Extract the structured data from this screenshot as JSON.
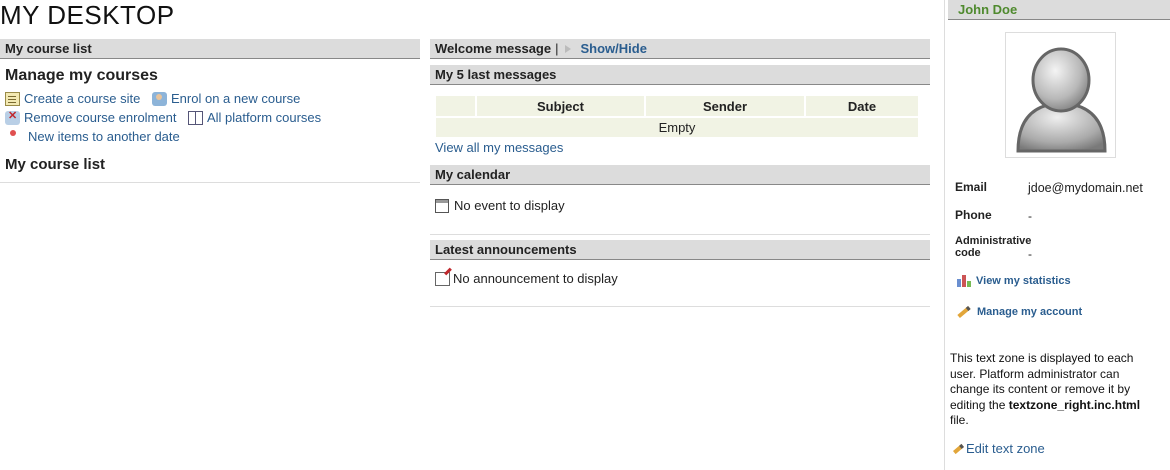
{
  "page_title": "MY DESKTOP",
  "left": {
    "bar_title": "My course list",
    "manage_title": "Manage my courses",
    "links": {
      "create": "Create a course site",
      "enrol": "Enrol on a new course",
      "remove": "Remove course enrolment",
      "all": "All platform courses",
      "new_items": "New items to another date"
    },
    "course_list_title": "My course list"
  },
  "mid": {
    "welcome": "Welcome message",
    "separator": "|",
    "show_hide": "Show/Hide",
    "messages_title": "My 5 last messages",
    "columns": [
      "Subject",
      "Sender",
      "Date"
    ],
    "empty": "Empty",
    "view_all": "View all my messages",
    "calendar_title": "My calendar",
    "calendar_empty": "No event to display",
    "announcements_title": "Latest announcements",
    "announcements_empty": "No announcement to display"
  },
  "right": {
    "user_name": "John Doe",
    "email_label": "Email",
    "email_value": "jdoe@mydomain.net",
    "phone_label": "Phone",
    "phone_value": "-",
    "admin_label": "Administrative code",
    "admin_value": "-",
    "stats_link": "View my statistics",
    "account_link": "Manage my account",
    "textzone_pre": "This text zone is displayed to each user. Platform administrator can change its content or remove it by editing the ",
    "textzone_file": "textzone_right.inc.html",
    "textzone_post": " file.",
    "edit_textzone": "Edit text zone"
  },
  "colors": {
    "link": "#2a5d8f",
    "bar": "#dcdcdc",
    "username": "#4f8a2e"
  }
}
